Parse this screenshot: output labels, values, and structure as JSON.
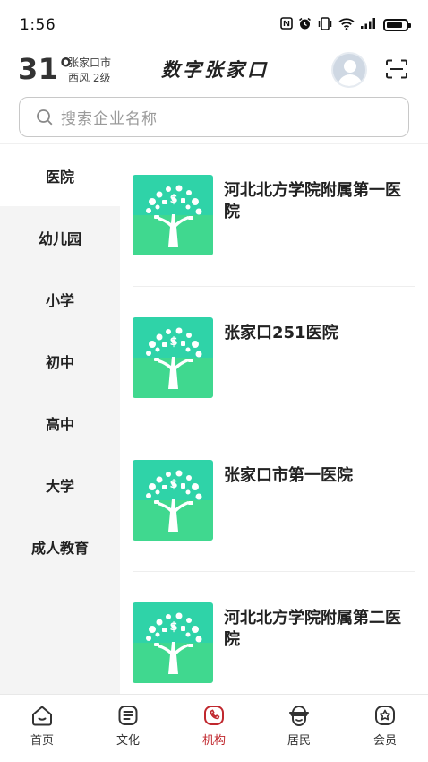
{
  "status_bar": {
    "time": "1:56",
    "icons": [
      "nfc-icon",
      "alarm-icon",
      "vibrate-icon",
      "wifi-icon",
      "signal-icon",
      "battery-icon"
    ]
  },
  "header": {
    "temperature": "31°",
    "city": "张家口市",
    "wind": "西风  2级",
    "app_title": "数字张家口"
  },
  "search": {
    "placeholder": "搜索企业名称"
  },
  "sidebar": {
    "active_index": 0,
    "items": [
      {
        "label": "医院"
      },
      {
        "label": "幼儿园"
      },
      {
        "label": "小学"
      },
      {
        "label": "初中"
      },
      {
        "label": "高中"
      },
      {
        "label": "大学"
      },
      {
        "label": "成人教育"
      }
    ]
  },
  "list": {
    "items": [
      {
        "name": "河北北方学院附属第一医院"
      },
      {
        "name": "张家口251医院"
      },
      {
        "name": "张家口市第一医院"
      },
      {
        "name": "河北北方学院附属第二医院"
      }
    ]
  },
  "colors": {
    "accent": "#c0282e",
    "thumb_gradient_top": "#2fd3a8",
    "thumb_gradient_bottom": "#4fdc7a"
  },
  "bottom_nav": {
    "active_index": 2,
    "items": [
      {
        "label": "首页",
        "icon": "home-icon"
      },
      {
        "label": "文化",
        "icon": "document-icon"
      },
      {
        "label": "机构",
        "icon": "phone-icon"
      },
      {
        "label": "居民",
        "icon": "people-icon"
      },
      {
        "label": "会员",
        "icon": "star-badge-icon"
      }
    ]
  }
}
